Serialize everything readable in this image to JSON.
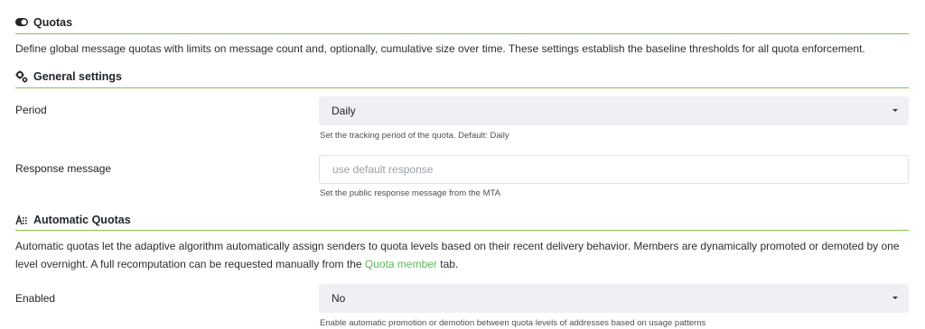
{
  "sections": {
    "quotas": {
      "title": "Quotas",
      "icon": "toggle-icon",
      "description": "Define global message quotas with limits on message count and, optionally, cumulative size over time. These settings establish the baseline thresholds for all quota enforcement."
    },
    "general": {
      "title": "General settings",
      "icon": "gears-icon",
      "period": {
        "label": "Period",
        "value": "Daily",
        "help": "Set the tracking period of the quota. Default: Daily"
      },
      "response": {
        "label": "Response message",
        "value": "",
        "placeholder": "use default response",
        "help": "Set the public response message from the MTA"
      }
    },
    "automatic": {
      "title": "Automatic Quotas",
      "icon": "auto-icon",
      "description_part1": "Automatic quotas let the adaptive algorithm automatically assign senders to quota levels based on their recent delivery behavior. Members are dynamically promoted or demoted by one level overnight. A full recomputation can be requested manually from the ",
      "link_text": "Quota member",
      "description_part2": " tab.",
      "enabled": {
        "label": "Enabled",
        "value": "No",
        "help": "Enable automatic promotion or demotion between quota levels of addresses based on usage patterns"
      }
    }
  },
  "colors": {
    "accent": "#8bc34a",
    "link": "#5cb85c",
    "select_bg": "#eef0f3"
  }
}
